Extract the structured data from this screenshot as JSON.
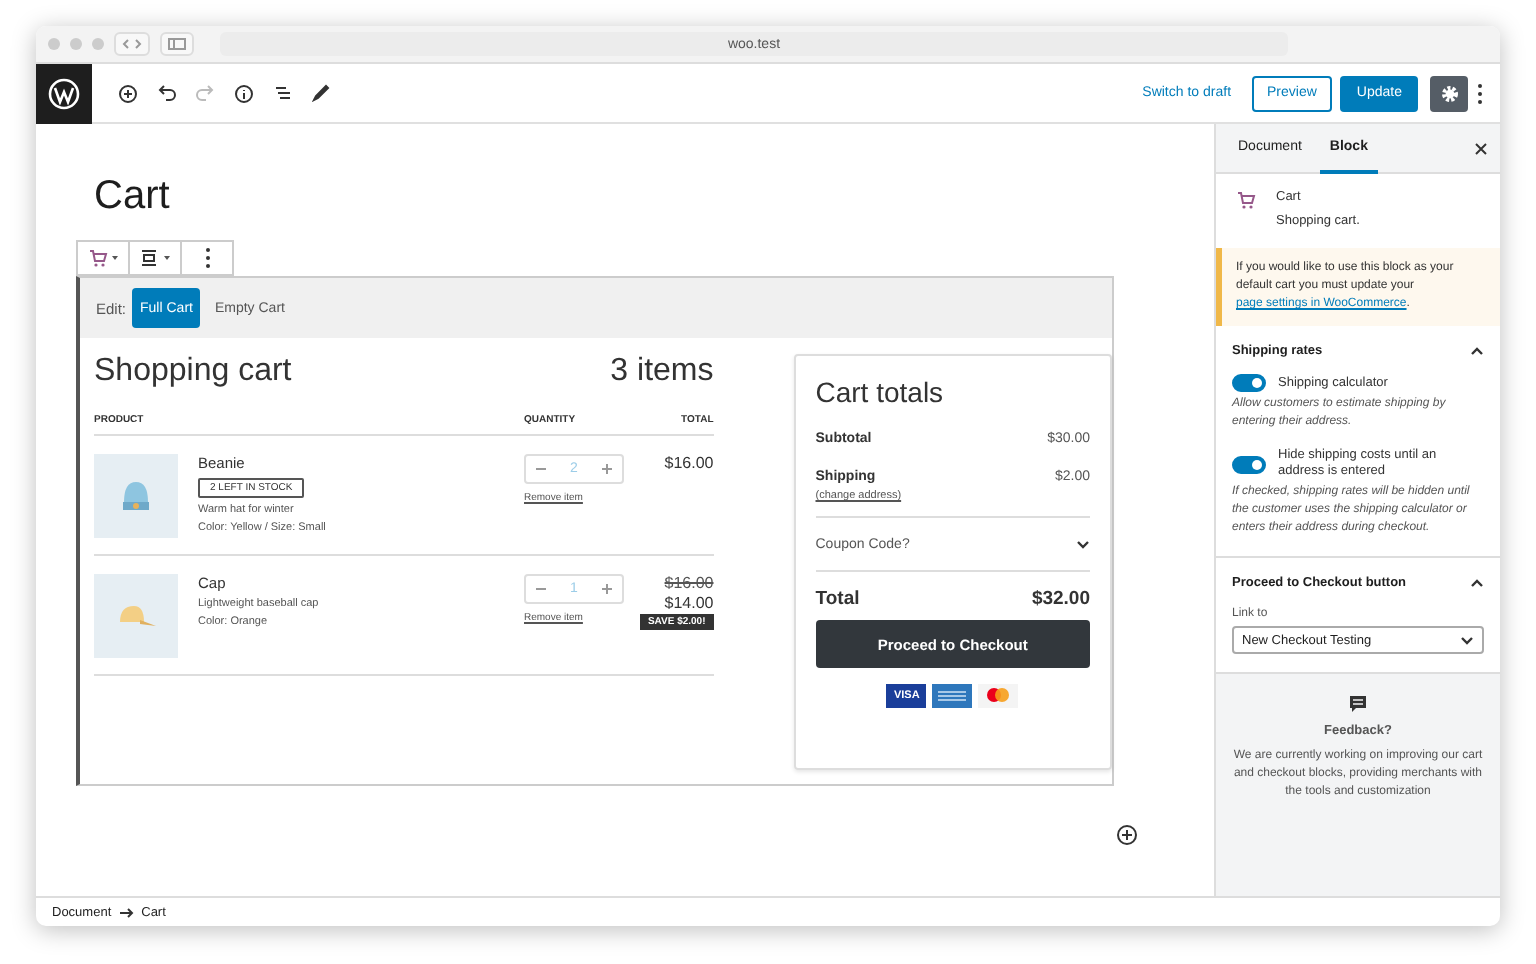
{
  "browser": {
    "url": "woo.test"
  },
  "toolbar": {
    "switch_draft": "Switch to draft",
    "preview": "Preview",
    "update": "Update",
    "settings_active": true
  },
  "page_title": "Cart",
  "edit_bar": {
    "label": "Edit:",
    "options": [
      {
        "label": "Full Cart",
        "selected": true
      },
      {
        "label": "Empty Cart",
        "selected": false
      }
    ]
  },
  "cart": {
    "heading": "Shopping cart",
    "count": "3 items",
    "columns": [
      "PRODUCT",
      "QUANTITY",
      "TOTAL"
    ],
    "items": [
      {
        "name": "Beanie",
        "badge": "2 LEFT IN STOCK",
        "description": "Warm hat for winter",
        "attributes": "Color: Yellow / Size: Small",
        "quantity": "2",
        "remove": "Remove item",
        "price": "$16.00"
      },
      {
        "name": "Cap",
        "description": "Lightweight baseball cap",
        "attributes": "Color: Orange",
        "quantity": "1",
        "remove": "Remove item",
        "original_price": "$16.00",
        "price": "$14.00",
        "save": "SAVE $2.00!"
      }
    ]
  },
  "totals": {
    "title": "Cart totals",
    "rows": [
      {
        "label": "Subtotal",
        "value": "$30.00"
      },
      {
        "label": "Shipping",
        "value": "$2.00",
        "link": "(change address)"
      }
    ],
    "coupon": "Coupon Code?",
    "total_label": "Total",
    "total_value": "$32.00",
    "checkout": "Proceed to Checkout",
    "payment_icons": [
      {
        "kind": "visa",
        "label": "VISA"
      },
      {
        "kind": "amex"
      },
      {
        "kind": "mastercard"
      }
    ]
  },
  "sidebar": {
    "tabs": [
      {
        "label": "Document",
        "selected": false
      },
      {
        "label": "Block",
        "selected": true
      }
    ],
    "block": {
      "name": "Cart",
      "description": "Shopping cart."
    },
    "notice": {
      "text": "If you would like to use this block as your default cart you must update your",
      "link": "page settings in WooCommerce",
      "after": "."
    },
    "shipping": {
      "title": "Shipping rates",
      "expanded": true,
      "toggles": [
        {
          "label": "Shipping calculator",
          "help": "Allow customers to estimate shipping by entering their address.",
          "on": true
        },
        {
          "label": "Hide shipping costs until an address is entered",
          "help": "If checked, shipping rates will be hidden until the customer uses the shipping calculator or enters their address during checkout.",
          "on": true
        }
      ]
    },
    "checkout_panel": {
      "title": "Proceed to Checkout button",
      "expanded": true,
      "field_label": "Link to",
      "value": "New Checkout Testing"
    },
    "feedback": {
      "title": "Feedback?",
      "text": "We are currently working on improving our cart and checkout blocks, providing merchants with the tools and customization"
    }
  },
  "breadcrumb": [
    "Document",
    "Cart"
  ]
}
